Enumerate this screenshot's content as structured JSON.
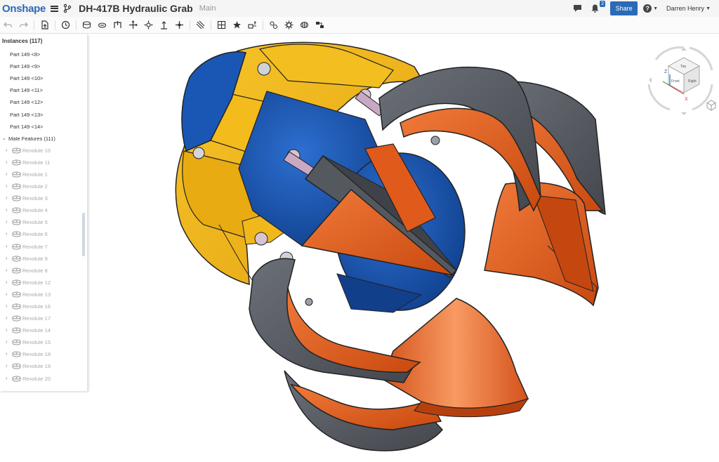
{
  "app": {
    "logo": "Onshape",
    "document_title": "DH-417B Hydraulic Grab",
    "workspace": "Main"
  },
  "topbar": {
    "notification_count": "2",
    "share_label": "Share",
    "help_glyph": "?",
    "user_name": "Darren Henry"
  },
  "toolbar": {
    "tools": [
      "undo-icon",
      "redo-icon",
      "insert-icon",
      "history-icon",
      "mate-icon",
      "slider-icon",
      "cylindrical-icon",
      "planar-icon",
      "ball-icon",
      "pin-slot-icon",
      "fastened-icon",
      "parallel-icon",
      "relation-icon",
      "group-icon",
      "mate-connector-icon",
      "replicate-icon",
      "pattern-icon",
      "explode-icon",
      "gear-relation-icon",
      "rack-icon",
      "screw-icon"
    ]
  },
  "panel": {
    "instances_header": "Instances (117)",
    "parts": [
      "Part 149 <8>",
      "Part 149 <9>",
      "Part 149 <10>",
      "Part 149 <11>",
      "Part 149 <12>",
      "Part 149 <13>",
      "Part 149 <14>"
    ],
    "mate_header": "Mate Features (111)",
    "mates": [
      "Revolute 10",
      "Revolute 11",
      "Revolute 1",
      "Revolute 2",
      "Revolute 3",
      "Revolute 4",
      "Revolute 5",
      "Revolute 6",
      "Revolute 7",
      "Revolute 9",
      "Revolute 8",
      "Revolute 12",
      "Revolute 13",
      "Revolute 16",
      "Revolute 17",
      "Revolute 14",
      "Revolute 15",
      "Revolute 18",
      "Revolute 19",
      "Revolute 20"
    ]
  },
  "viewcube": {
    "top_label": "Top",
    "front_label": "Front",
    "right_label": "Right",
    "axis_x": "X",
    "axis_z": "Z"
  },
  "colors": {
    "brand": "#2a6ab8",
    "yellow_body": "#f0b414",
    "blue_body": "#1a57b5",
    "orange_jaw": "#e25a1c",
    "gray_jaw": "#5c6068"
  }
}
